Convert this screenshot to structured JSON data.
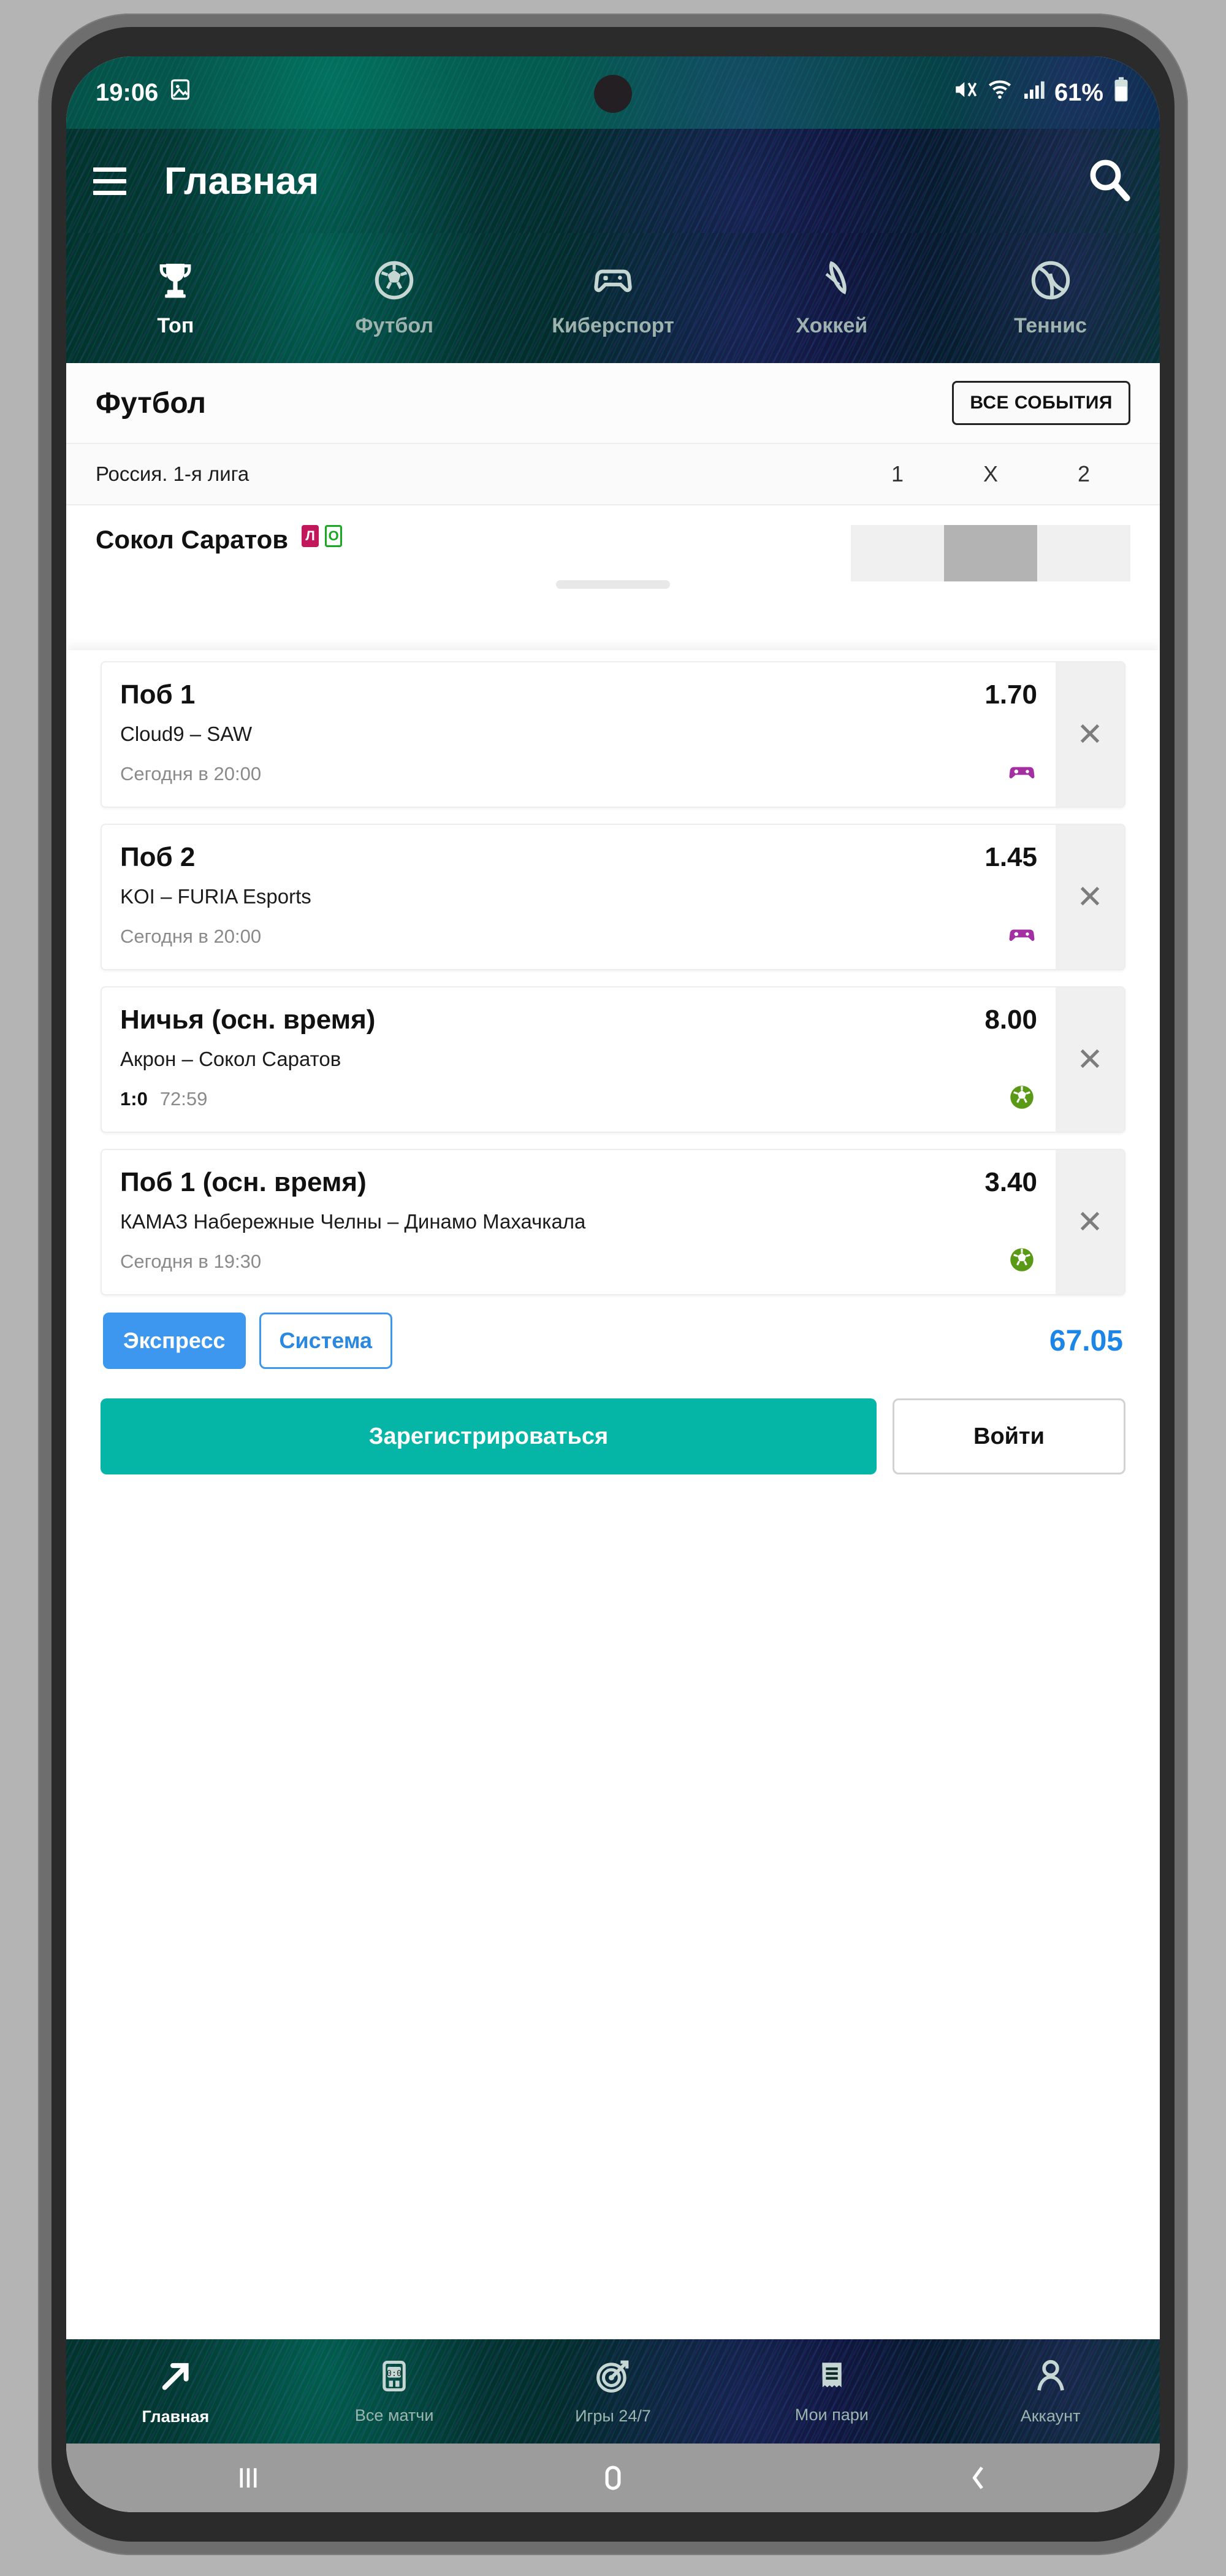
{
  "status_bar": {
    "time": "19:06",
    "left_icons": [
      "image-icon"
    ],
    "right_icons": [
      "mute-icon",
      "wifi-icon",
      "cellular-signal-icon"
    ],
    "battery_percent": "61%"
  },
  "header": {
    "title": "Главная",
    "menu_icon": "hamburger-menu-icon",
    "search_icon": "search-icon"
  },
  "sport_tabs": [
    {
      "label": "Топ",
      "icon": "trophy-icon",
      "active": true
    },
    {
      "label": "Футбол",
      "icon": "soccer-ball-icon",
      "active": false
    },
    {
      "label": "Киберспорт",
      "icon": "gamepad-icon",
      "active": false
    },
    {
      "label": "Хоккей",
      "icon": "hockey-puck-icon",
      "active": false
    },
    {
      "label": "Теннис",
      "icon": "tennis-ball-icon",
      "active": false
    }
  ],
  "section": {
    "title": "Футбол",
    "all_events_label": "ВСЕ СОБЫТИЯ"
  },
  "league_row": {
    "name": "Россия. 1-я лига",
    "columns": [
      "1",
      "X",
      "2"
    ]
  },
  "match_row": {
    "team": "Сокол Саратов",
    "badges": [
      "Л",
      "О"
    ]
  },
  "betslip": {
    "cards": [
      {
        "market": "Поб 1",
        "odd": "1.70",
        "teams": "Cloud9 – SAW",
        "time": "Сегодня в 20:00",
        "score": "",
        "sport_icon": "gamepad-icon",
        "sport_color": "#a32fa3",
        "remove_icon": "close-icon"
      },
      {
        "market": "Поб 2",
        "odd": "1.45",
        "teams": "KOI – FURIA Esports",
        "time": "Сегодня в 20:00",
        "score": "",
        "sport_icon": "gamepad-icon",
        "sport_color": "#a32fa3",
        "remove_icon": "close-icon"
      },
      {
        "market": "Ничья (осн. время)",
        "odd": "8.00",
        "teams": "Акрон – Сокол Саратов",
        "time": "72:59",
        "score": "1:0",
        "sport_icon": "soccer-ball-icon",
        "sport_color": "#5a9916",
        "remove_icon": "close-icon"
      },
      {
        "market": "Поб 1 (осн. время)",
        "odd": "3.40",
        "teams": "КАМАЗ Набережные Челны – Динамо Махачкала",
        "time": "Сегодня в 19:30",
        "score": "",
        "sport_icon": "soccer-ball-icon",
        "sport_color": "#5a9916",
        "remove_icon": "close-icon"
      }
    ],
    "mode_express": "Экспресс",
    "mode_system": "Система",
    "total_odds": "67.05",
    "register_label": "Зарегистрироваться",
    "login_label": "Войти"
  },
  "bottom_nav": [
    {
      "label": "Главная",
      "icon": "arrow-up-right-icon",
      "active": true
    },
    {
      "label": "Все матчи",
      "icon": "scoreboard-icon",
      "active": false
    },
    {
      "label": "Игры 24/7",
      "icon": "target-dart-icon",
      "active": false
    },
    {
      "label": "Мои пари",
      "icon": "receipt-icon",
      "active": false
    },
    {
      "label": "Аккаунт",
      "icon": "person-icon",
      "active": false
    }
  ],
  "android_nav": [
    {
      "icon": "recents-icon"
    },
    {
      "icon": "home-circle-icon"
    },
    {
      "icon": "back-chevron-icon"
    }
  ],
  "colors": {
    "accent_green": "#05b5a6",
    "accent_blue": "#3d97ef",
    "total_blue": "#1b85e8",
    "esports_purple": "#a32fa3",
    "football_green": "#5a9916",
    "header_dark": "#04312c"
  }
}
